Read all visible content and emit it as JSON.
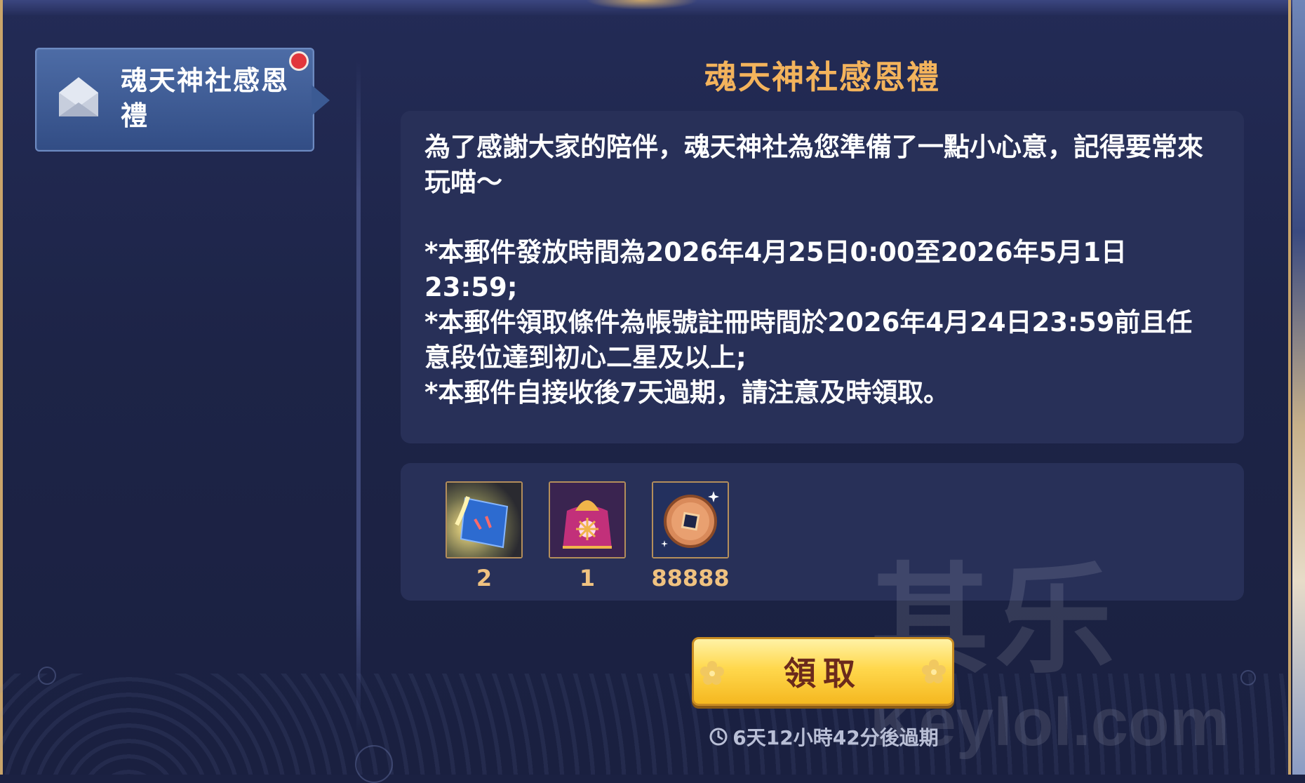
{
  "sidebar": {
    "mail_items": [
      {
        "title": "魂天神社感恩禮",
        "unread": true,
        "icon": "envelope-open-icon"
      }
    ]
  },
  "mail": {
    "title": "魂天神社感恩禮",
    "body": [
      "為了感謝大家的陪伴，魂天神社為您準備了一點小心意，記得要常來玩喵～",
      "",
      "*本郵件發放時間為2026年4月25日0:00至2026年5月1日23:59;",
      "*本郵件領取條件為帳號註冊時間於2026年4月24日23:59前且任意段位達到初心二星及以上;",
      "*本郵件自接收後7天過期，請注意及時領取。"
    ],
    "rewards": [
      {
        "icon": "ticket-scroll-icon",
        "count": "2"
      },
      {
        "icon": "gift-bag-icon",
        "count": "1"
      },
      {
        "icon": "copper-coin-icon",
        "count": "88888"
      }
    ],
    "claim_label": "領取",
    "expiry_text": "6天12小時42分後過期"
  },
  "watermark": {
    "mark": "其乐",
    "domain": "Keylol.com"
  },
  "colors": {
    "title": "#f3b35c",
    "claim_button": "#ffd84d",
    "unread_dot": "#e1363c",
    "panel_bg": "#1d2447"
  }
}
